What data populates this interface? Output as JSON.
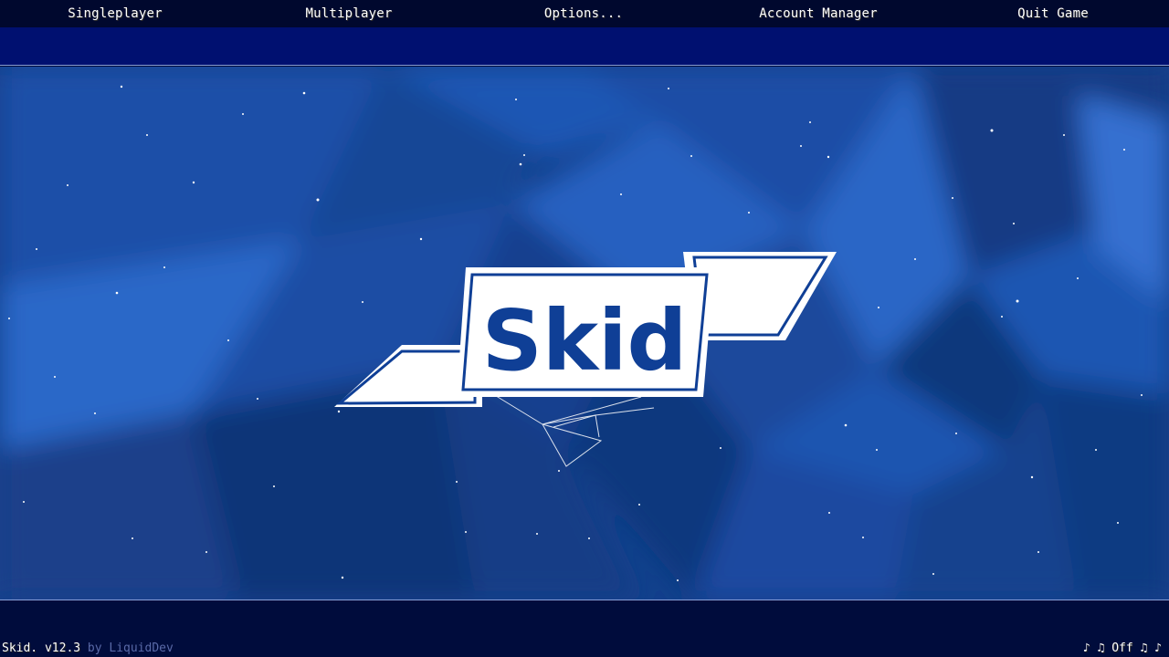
{
  "menu": {
    "singleplayer": "Singleplayer",
    "multiplayer": "Multiplayer",
    "options": "Options...",
    "account_manager": "Account Manager",
    "quit": "Quit Game"
  },
  "logo": {
    "text": "Skid"
  },
  "footer": {
    "version": "Skid. v12.3",
    "author": " by LiquidDev",
    "music_prefix": "♪ ♫ ",
    "music_state": "Off",
    "music_suffix": " ♫ ♪"
  },
  "colors": {
    "bar_dark": "#00082e",
    "bar_blue": "#001070",
    "logo_blue": "#0f3f96",
    "background": "#12408c"
  }
}
